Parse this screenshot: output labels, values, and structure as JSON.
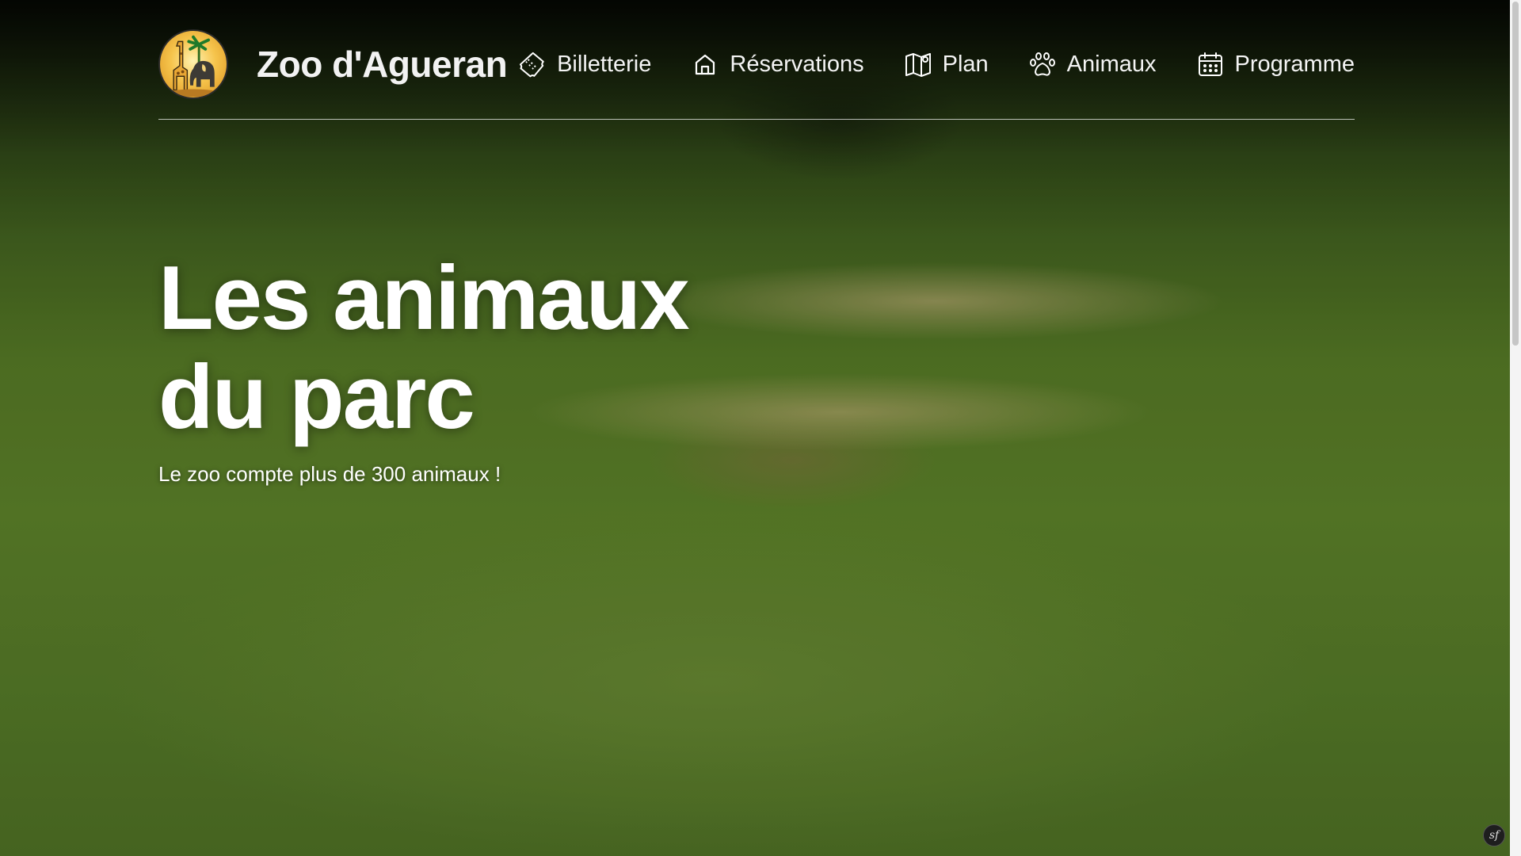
{
  "site": {
    "brand_name": "Zoo d'Agueran"
  },
  "nav": {
    "items": [
      {
        "label": "Billetterie",
        "icon": "ticket-icon"
      },
      {
        "label": "Réservations",
        "icon": "home-icon"
      },
      {
        "label": "Plan",
        "icon": "map-icon"
      },
      {
        "label": "Animaux",
        "icon": "paw-icon"
      },
      {
        "label": "Programme",
        "icon": "calendar-icon"
      }
    ]
  },
  "hero": {
    "title_line1": "Les animaux",
    "title_line2": "du parc",
    "subtitle": "Le zoo compte plus de 300 animaux !",
    "background_image": "cheetahs-resting-on-grass"
  },
  "corner_badge": {
    "text": "sf"
  },
  "colors": {
    "text": "#ffffff",
    "logo_fill": "#f6c44c",
    "divider": "#ffffff"
  }
}
